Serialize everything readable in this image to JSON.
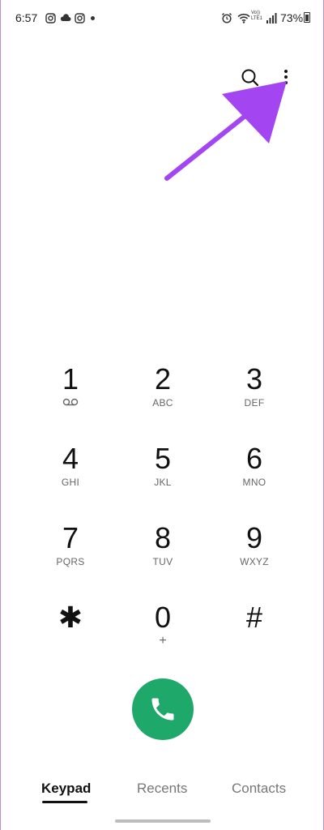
{
  "status_bar": {
    "time": "6:57",
    "battery": "73%",
    "volte_line1": "Vo))",
    "volte_line2": "LTE1"
  },
  "header": {
    "search_icon": "search-icon",
    "more_icon": "more-options-icon"
  },
  "keypad": {
    "keys": [
      {
        "digit": "1",
        "sub": ""
      },
      {
        "digit": "2",
        "sub": "ABC"
      },
      {
        "digit": "3",
        "sub": "DEF"
      },
      {
        "digit": "4",
        "sub": "GHI"
      },
      {
        "digit": "5",
        "sub": "JKL"
      },
      {
        "digit": "6",
        "sub": "MNO"
      },
      {
        "digit": "7",
        "sub": "PQRS"
      },
      {
        "digit": "8",
        "sub": "TUV"
      },
      {
        "digit": "9",
        "sub": "WXYZ"
      },
      {
        "digit": "✱",
        "sub": ""
      },
      {
        "digit": "0",
        "sub": "+"
      },
      {
        "digit": "#",
        "sub": ""
      }
    ]
  },
  "call_button": {
    "icon": "phone-icon",
    "color": "#1ea86a"
  },
  "tabs": [
    {
      "label": "Keypad",
      "active": true
    },
    {
      "label": "Recents",
      "active": false
    },
    {
      "label": "Contacts",
      "active": false
    }
  ],
  "colors": {
    "annotation_arrow": "#a445f2",
    "call_green": "#1ea86a"
  }
}
